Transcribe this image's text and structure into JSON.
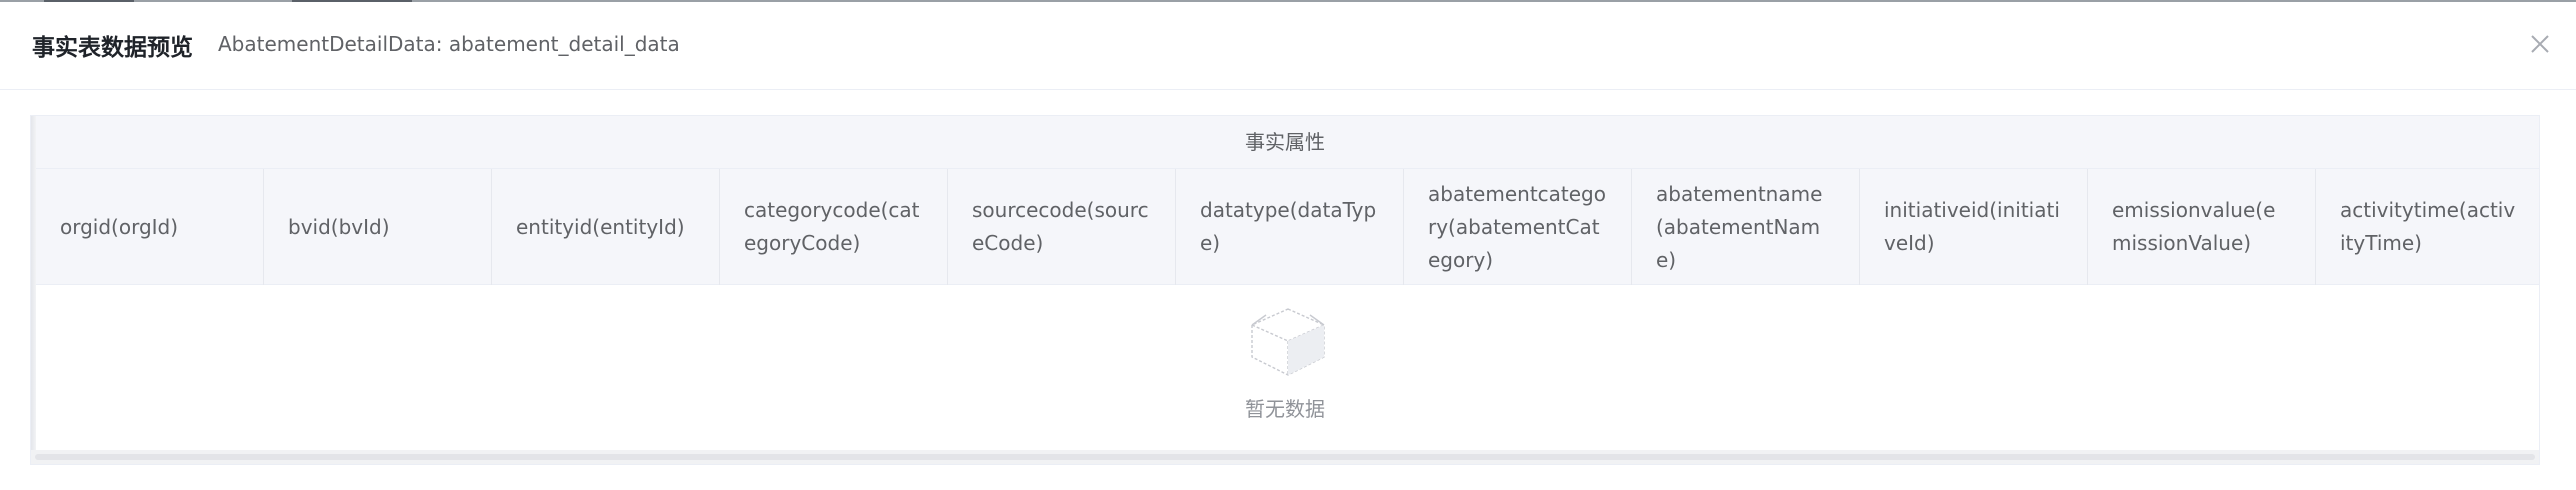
{
  "dialog": {
    "title": "事实表数据预览",
    "subtitle": "AbatementDetailData: abatement_detail_data",
    "close_icon": "close-icon"
  },
  "table": {
    "group_header": "事实属性",
    "columns": [
      "orgid(orgId)",
      "bvid(bvId)",
      "entityid(entityId)",
      "categorycode(categoryCode)",
      "sourcecode(sourceCode)",
      "datatype(dataType)",
      "abatementcategory(abatementCategory)",
      "abatementname(abatementName)",
      "initiativeid(initiativeId)",
      "emissionvalue(emissionValue)",
      "activitytime(activityTime)"
    ],
    "rows": [],
    "empty_text": "暂无数据",
    "empty_icon": "empty-box-icon"
  },
  "colors": {
    "header_bg": "#f5f6fa",
    "border": "#ebeef5",
    "text": "#606266",
    "muted": "#909399"
  }
}
